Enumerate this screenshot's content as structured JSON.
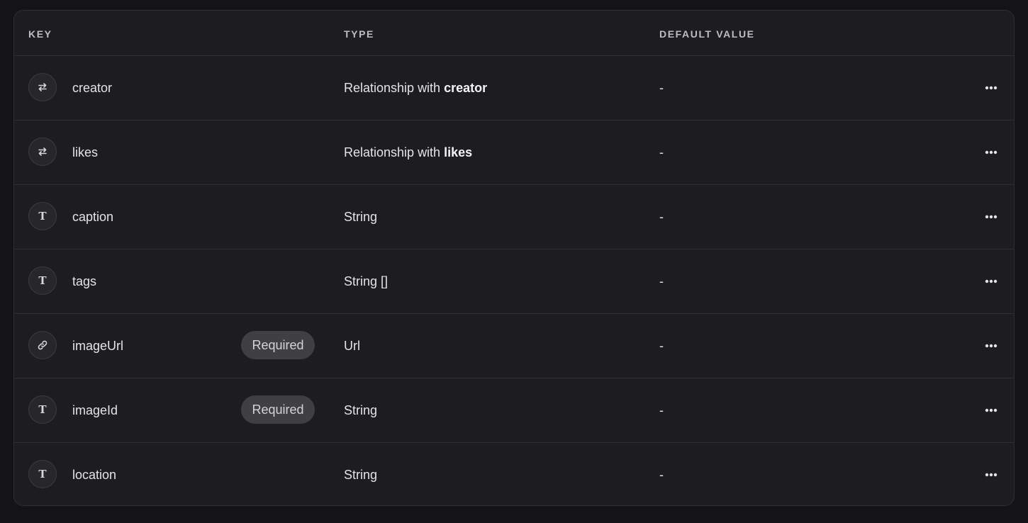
{
  "columns": {
    "key": "KEY",
    "type": "TYPE",
    "default": "DEFAULT VALUE"
  },
  "rows": [
    {
      "icon": "relationship-icon",
      "key": "creator",
      "type_text": "Relationship with ",
      "type_bold": "creator",
      "badge": "",
      "default": "-"
    },
    {
      "icon": "relationship-icon",
      "key": "likes",
      "type_text": "Relationship with ",
      "type_bold": "likes",
      "badge": "",
      "default": "-"
    },
    {
      "icon": "text-icon",
      "key": "caption",
      "type_text": "String",
      "type_bold": "",
      "badge": "",
      "default": "-"
    },
    {
      "icon": "text-icon",
      "key": "tags",
      "type_text": "String []",
      "type_bold": "",
      "badge": "",
      "default": "-"
    },
    {
      "icon": "link-icon",
      "key": "imageUrl",
      "type_text": "Url",
      "type_bold": "",
      "badge": "Required",
      "default": "-"
    },
    {
      "icon": "text-icon",
      "key": "imageId",
      "type_text": "String",
      "type_bold": "",
      "badge": "Required",
      "default": "-"
    },
    {
      "icon": "text-icon",
      "key": "location",
      "type_text": "String",
      "type_bold": "",
      "badge": "",
      "default": "-"
    }
  ],
  "icons": {
    "text_glyph": "T",
    "more": "more-horizontal-icon"
  },
  "colors": {
    "background": "#141416",
    "card": "#1d1d21",
    "border": "#2e2e33",
    "badge": "#3f3f44"
  }
}
